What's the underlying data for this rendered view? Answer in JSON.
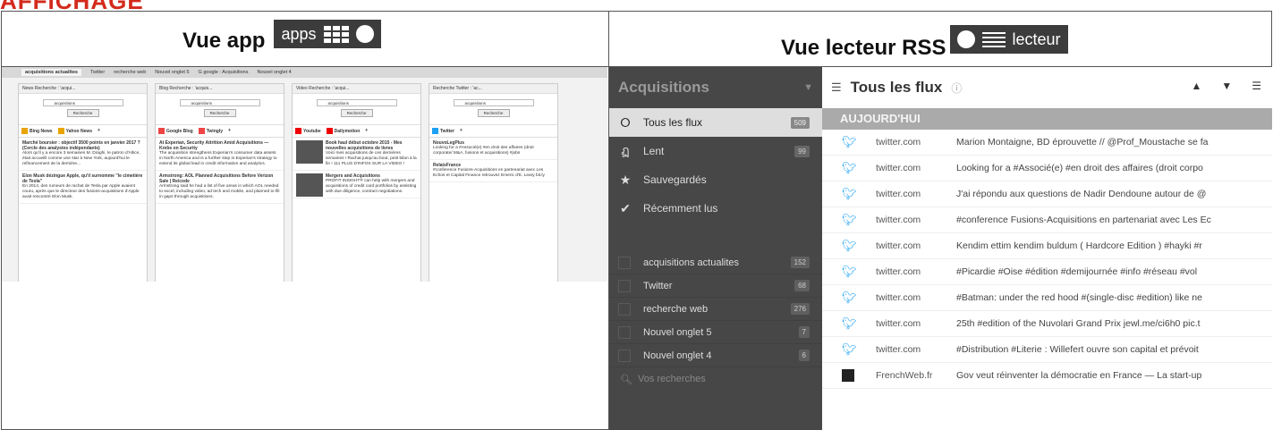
{
  "heading": "AFFICHAGE",
  "left_header": {
    "label": "Vue app",
    "badge": "apps"
  },
  "right_header": {
    "label": "Vue lecteur RSS",
    "badge": "lecteur"
  },
  "app_view": {
    "tabs": [
      "acquisitions actualites",
      "Twitter",
      "recherche web",
      "Nouvel onglet 5",
      "G google : Acquisitions",
      "Nouvel onglet 4"
    ],
    "panels": [
      {
        "title": "News Recherche : 'acqui...",
        "query": "acquisitions",
        "button": "Recherche",
        "tabs": [
          "Bing News",
          "Yahoo News",
          "+"
        ],
        "entries": [
          {
            "headline": "Marché boursier : objectif 3500 points en janvier 2017 ? (Cercle des analystes indépendants)",
            "body": "Alors qu'il y a encore 3 semaines M. Draghi, le patron d'Altice, était accueilli comme une star à New York, aujourd'hui le refinancement de la dernière..."
          },
          {
            "headline": "Elon Musk dézingue Apple, qu'il surnomme \"le cimetière de Tesla\"",
            "body": "En 2014, des rumeurs de rachat de Tesla par Apple avaient couru, après que le directeur des fusions-acquisitions d'Apple avait rencontré Elon Musk."
          }
        ]
      },
      {
        "title": "Blog Recherche : 'acquis...",
        "query": "acquisitions",
        "button": "Recherche",
        "tabs": [
          "Google Blog",
          "Twingly",
          "+"
        ],
        "entries": [
          {
            "headline": "At Experian, Security Attrition Amid Acquisitions — Krebs on Security",
            "body": "The acquisition strengthens Experian's consumer data assets in North America and is a further step in Experian's strategy to extend its global lead in credit information and analytics."
          },
          {
            "headline": "Armstrong: AOL Planned Acquisitions Before Verizon Sale | Re/code",
            "body": "Armstrong said he had a list of five areas in which AOL needed to excel, including video, ad tech and mobile, and planned to fill in gaps through acquisitions."
          }
        ]
      },
      {
        "title": "Video Recherche : 'acqui...",
        "query": "acquisitions",
        "button": "Recherche",
        "tabs": [
          "Youtube",
          "Dailymotion",
          "+"
        ],
        "entries": [
          {
            "headline": "Book haul début octobre 2015 - Mes nouvelles acquisitions de livres",
            "body": "Voici mes acquisitions de ces dernières semaines ! Rachat jusqu'au bout, petit bilan à la fin ! 111 PLUS D'INFOS SUR LA VIDEO !"
          },
          {
            "headline": "Mergers and Acquisitions",
            "body": "PROFIT INSIGHT® can help with mergers and acquisitions of credit card portfolios by assisting with due diligence, contract negotiations."
          }
        ]
      },
      {
        "title": "Recherche Twitter : 'ac...",
        "query": "acquisitions",
        "button": "Recherche",
        "tabs": [
          "Twitter",
          "+"
        ],
        "entries": [
          {
            "headline": "NouvoLegPlus",
            "body": "Looking for a #Associé(e) #en droit des affaires (droit corporate/ M&A, fusions et acquisitions) #jobs"
          },
          {
            "headline": "RelaisFrance",
            "body": "#conference Fusions-Acquisitions en partenariat avec Les Echos et Capital Finance retrouvez Emeric d'E. Leary bit.ly"
          }
        ]
      }
    ]
  },
  "rss": {
    "sidebar_title": "Acquisitions",
    "nav": [
      {
        "label": "Tous les flux",
        "count": "509",
        "icon": "rss-icon",
        "glyph": "⭘"
      },
      {
        "label": "Lent",
        "count": "99",
        "icon": "snail-icon",
        "glyph": "ฏ"
      },
      {
        "label": "Sauvegardés",
        "count": "",
        "icon": "star-icon",
        "glyph": "★"
      },
      {
        "label": "Récemment lus",
        "count": "",
        "icon": "check-circle-icon",
        "glyph": "✔"
      }
    ],
    "feeds": [
      {
        "label": "acquisitions actualites",
        "count": "152"
      },
      {
        "label": "Twitter",
        "count": "68"
      },
      {
        "label": "recherche web",
        "count": "276"
      },
      {
        "label": "Nouvel onglet 5",
        "count": "7"
      },
      {
        "label": "Nouvel onglet 4",
        "count": "6"
      }
    ],
    "search_placeholder": "Vos recherches",
    "main_title": "Tous les flux",
    "band_label": "AUJOURD'HUI",
    "items": [
      {
        "source": "twitter.com",
        "text": "Marion Montaigne, BD éprouvette // @Prof_Moustache se fa"
      },
      {
        "source": "twitter.com",
        "text": "Looking for a #Associé(e) #en droit des affaires (droit corpo"
      },
      {
        "source": "twitter.com",
        "text": "J'ai répondu aux questions de Nadir Dendoune autour de @"
      },
      {
        "source": "twitter.com",
        "text": "#conference Fusions-Acquisitions en partenariat avec Les Ec"
      },
      {
        "source": "twitter.com",
        "text": "Kendim ettim kendim buldum ( Hardcore Edition ) #hayki #r"
      },
      {
        "source": "twitter.com",
        "text": "#Picardie #Oise #édition #demijournée #info #réseau #vol"
      },
      {
        "source": "twitter.com",
        "text": "#Batman: under the red hood #(single-disc #edition) like ne"
      },
      {
        "source": "twitter.com",
        "text": "25th #edition of the Nuvolari Grand Prix jewl.me/ci6h0 pic.t"
      },
      {
        "source": "twitter.com",
        "text": "#Distribution #Literie : Willefert ouvre son capital et prévoit"
      },
      {
        "source": "FrenchWeb.fr",
        "text": "Gov veut réinventer la démocratie en France — La start-up"
      }
    ]
  }
}
